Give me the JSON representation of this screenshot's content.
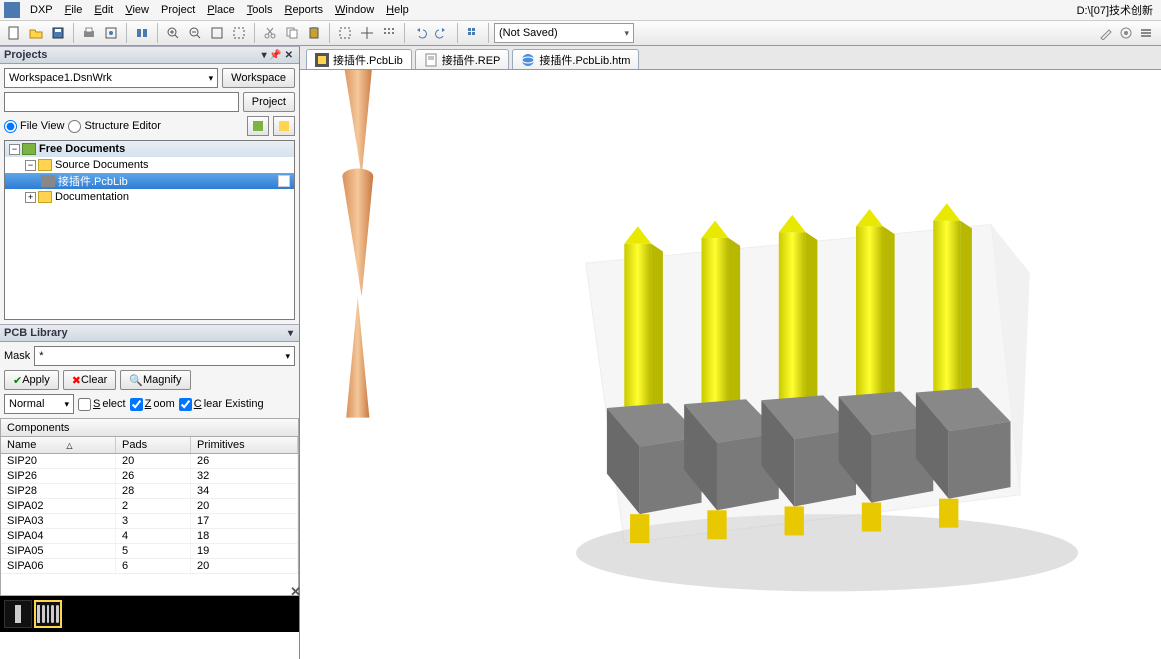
{
  "menu": {
    "app": "DXP",
    "items": [
      "File",
      "Edit",
      "View",
      "Project",
      "Place",
      "Tools",
      "Reports",
      "Window",
      "Help"
    ],
    "path": "D:\\[07]技术创新"
  },
  "toolbar": {
    "save_dropdown": "(Not Saved)"
  },
  "projects": {
    "title": "Projects",
    "workspace": "Workspace1.DsnWrk",
    "workspace_btn": "Workspace",
    "project_btn": "Project",
    "file_view": "File View",
    "structure_editor": "Structure Editor",
    "tree": {
      "root": "Free Documents",
      "src": "Source Documents",
      "file": "接插件.PcbLib",
      "doc": "Documentation"
    }
  },
  "pcblib": {
    "title": "PCB Library",
    "mask_label": "Mask",
    "mask_value": "*",
    "apply": "Apply",
    "clear": "Clear",
    "magnify": "Magnify",
    "mode": "Normal",
    "select": "Select",
    "zoom": "Zoom",
    "clear_existing": "Clear Existing"
  },
  "grid": {
    "title": "Components",
    "cols": [
      "Name",
      "Pads",
      "Primitives"
    ],
    "rows": [
      {
        "name": "SIP20",
        "pads": "20",
        "prim": "26"
      },
      {
        "name": "SIP26",
        "pads": "26",
        "prim": "32"
      },
      {
        "name": "SIP28",
        "pads": "28",
        "prim": "34"
      },
      {
        "name": "SIPA02",
        "pads": "2",
        "prim": "20"
      },
      {
        "name": "SIPA03",
        "pads": "3",
        "prim": "17"
      },
      {
        "name": "SIPA04",
        "pads": "4",
        "prim": "18"
      },
      {
        "name": "SIPA05",
        "pads": "5",
        "prim": "19"
      },
      {
        "name": "SIPA06",
        "pads": "6",
        "prim": "20"
      }
    ]
  },
  "tabs": [
    {
      "label": "接插件.PcbLib",
      "icon": "pcb"
    },
    {
      "label": "接插件.REP",
      "icon": "txt"
    },
    {
      "label": "接插件.PcbLib.htm",
      "icon": "htm"
    }
  ]
}
